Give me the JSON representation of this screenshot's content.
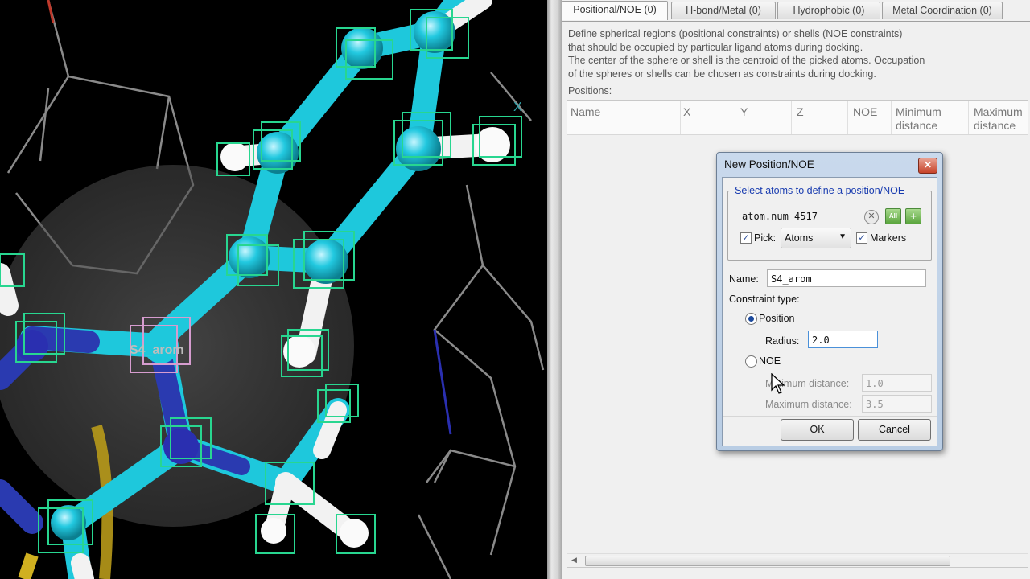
{
  "viewer": {
    "atom_label": "S4_arom",
    "axis_label": "X"
  },
  "tabs": [
    {
      "label": "Positional/NOE (0)",
      "active": true
    },
    {
      "label": "H-bond/Metal (0)",
      "active": false
    },
    {
      "label": "Hydrophobic (0)",
      "active": false
    },
    {
      "label": "Metal Coordination (0)",
      "active": false
    }
  ],
  "description": [
    "Define spherical regions (positional constraints) or shells (NOE constraints)",
    "that should be occupied by particular ligand atoms during docking.",
    "The center of the sphere or shell is the centroid of the picked atoms. Occupation",
    "of the spheres or shells can be chosen as constraints during docking."
  ],
  "positions_label": "Positions:",
  "table": {
    "columns": [
      "Name",
      "X",
      "Y",
      "Z",
      "NOE",
      "Minimum distance",
      "Maximum distance"
    ]
  },
  "dialog": {
    "title": "New Position/NOE",
    "close_icon": "close-icon",
    "group_title": "Select atoms to define a position/NOE",
    "atom_input_value": "atom.num 4517",
    "all_button": "All",
    "add_button": "+",
    "pick_label": "Pick:",
    "pick_checked": true,
    "pick_option": "Atoms",
    "markers_label": "Markers",
    "markers_checked": true,
    "name_label": "Name:",
    "name_value": "S4_arom",
    "constraint_label": "Constraint type:",
    "position_label": "Position",
    "radius_label": "Radius:",
    "radius_value": "2.0",
    "noe_label": "NOE",
    "min_label": "Minimum distance:",
    "min_value": "1.0",
    "max_label": "Maximum distance:",
    "max_value": "3.5",
    "ok_label": "OK",
    "cancel_label": "Cancel",
    "selected_constraint": "Position"
  },
  "colors": {
    "ligand": "#1ec8dc",
    "hydrogen": "#f2f2f2",
    "nitrogen": "#2a2fb0",
    "marker": "#28d690",
    "accent": "#1a3db0"
  }
}
